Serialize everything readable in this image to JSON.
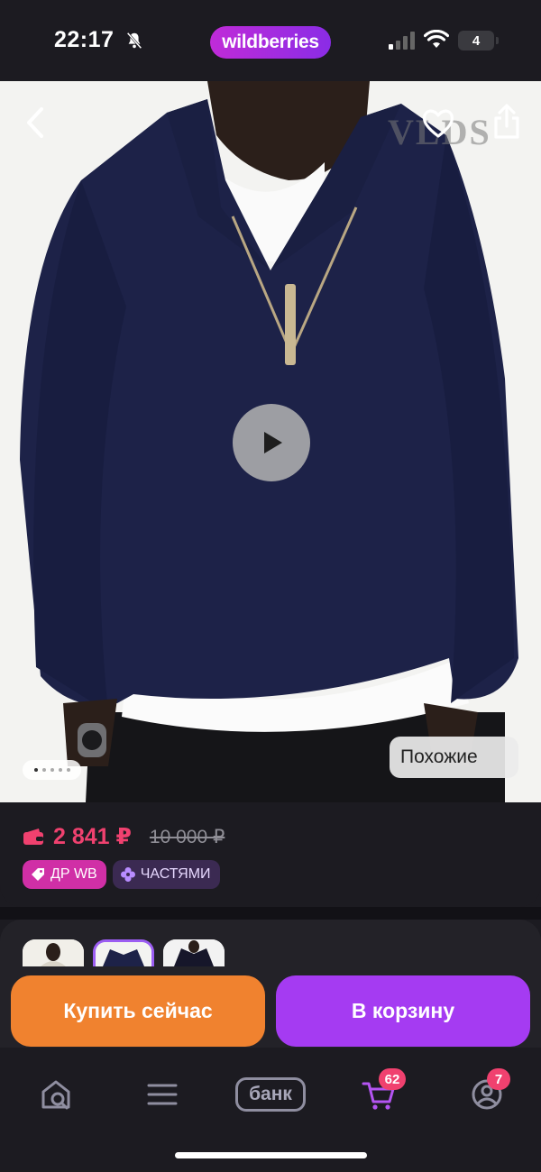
{
  "status_bar": {
    "time": "22:17",
    "app_badge": "wildberries",
    "battery_level": "4",
    "icons": [
      "bell-muted-icon",
      "cellular-signal-icon",
      "wifi-icon",
      "battery-icon"
    ]
  },
  "hero": {
    "brand_watermark": "VLDS",
    "similar_label": "Похожие",
    "pagination": {
      "total": 5,
      "current": 1
    },
    "icons": [
      "back-arrow-icon",
      "heart-icon",
      "share-icon",
      "play-icon"
    ]
  },
  "price": {
    "current": "2 841 ₽",
    "old": "10 000 ₽",
    "badges": [
      {
        "label": "ДР WB",
        "color": "#d02fa6",
        "icon": "tag-icon"
      },
      {
        "label": "ЧАСТЯМИ",
        "color": "#3b2a52",
        "icon": "split-payment-icon"
      }
    ]
  },
  "thumbnails": {
    "count": 3,
    "selected": 2
  },
  "actions": {
    "buy_now": "Купить сейчас",
    "add_to_cart": "В корзину"
  },
  "bottom_nav": {
    "bank_label": "банк",
    "cart_count": "62",
    "profile_count": "7",
    "items": [
      "home-search-icon",
      "catalog-icon",
      "bank-icon",
      "cart-icon",
      "profile-icon"
    ]
  },
  "colors": {
    "background": "#1c1b21",
    "accent_pink": "#f0416f",
    "buy_orange": "#f0822f",
    "cart_purple": "#a53bf2"
  }
}
